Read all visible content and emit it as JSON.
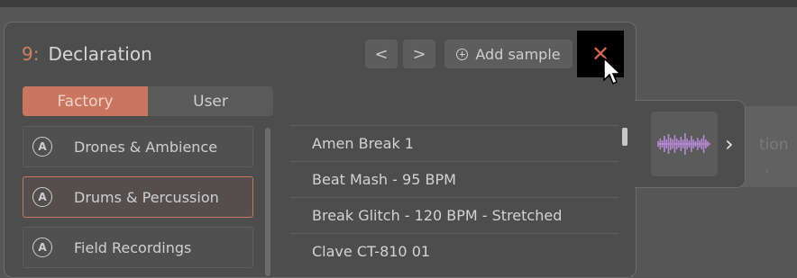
{
  "dialog": {
    "number": "9:",
    "title": "Declaration",
    "prev_label": "<",
    "next_label": ">",
    "add_sample_label": "Add sample",
    "close_label": "✕"
  },
  "tabs": [
    {
      "label": "Factory",
      "active": true
    },
    {
      "label": "User",
      "active": false
    }
  ],
  "categories": [
    {
      "label": "Drones & Ambience",
      "selected": false
    },
    {
      "label": "Drums & Percussion",
      "selected": true
    },
    {
      "label": "Field Recordings",
      "selected": false
    }
  ],
  "category_icon_glyph": "A",
  "samples": [
    "Amen Break 1",
    "Beat Mash - 95 BPM",
    "Break Glitch - 120 BPM - Stretched",
    "Clave CT-810 01"
  ],
  "side_panel": {
    "chevron": "›"
  },
  "background": {
    "ghost_text": "tion",
    "ghost_chevron": "›"
  },
  "colors": {
    "accent": "#c97661",
    "waveform": "#b48ad8",
    "close_x": "#d3664f"
  }
}
